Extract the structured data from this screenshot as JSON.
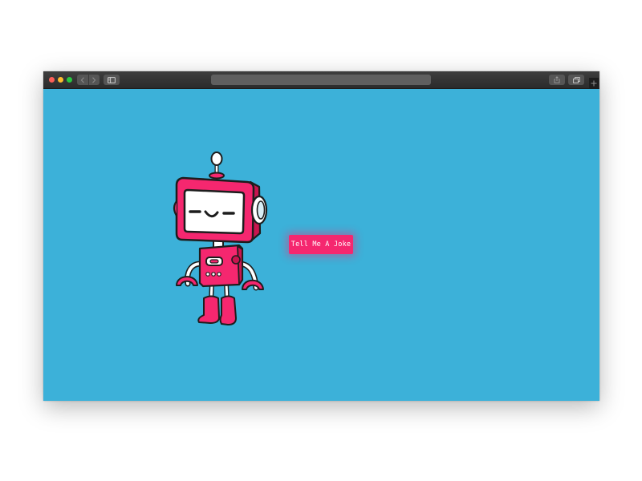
{
  "browser": {
    "address_text": "",
    "colors": {
      "titlebar": "#2f2f2f",
      "close": "#fc5f57",
      "minimize": "#fdbc2e",
      "maximize": "#28c840"
    }
  },
  "page": {
    "background": "#3cb1d9",
    "joke_button_label": "Tell Me A Joke",
    "accent": "#f5276f"
  },
  "icons": {
    "back": "chevron-left-icon",
    "forward": "chevron-right-icon",
    "sidebar": "sidebar-icon",
    "share": "share-icon",
    "tabs": "tabs-icon",
    "new_tab": "plus-icon"
  },
  "illustration": "robot-illustration"
}
